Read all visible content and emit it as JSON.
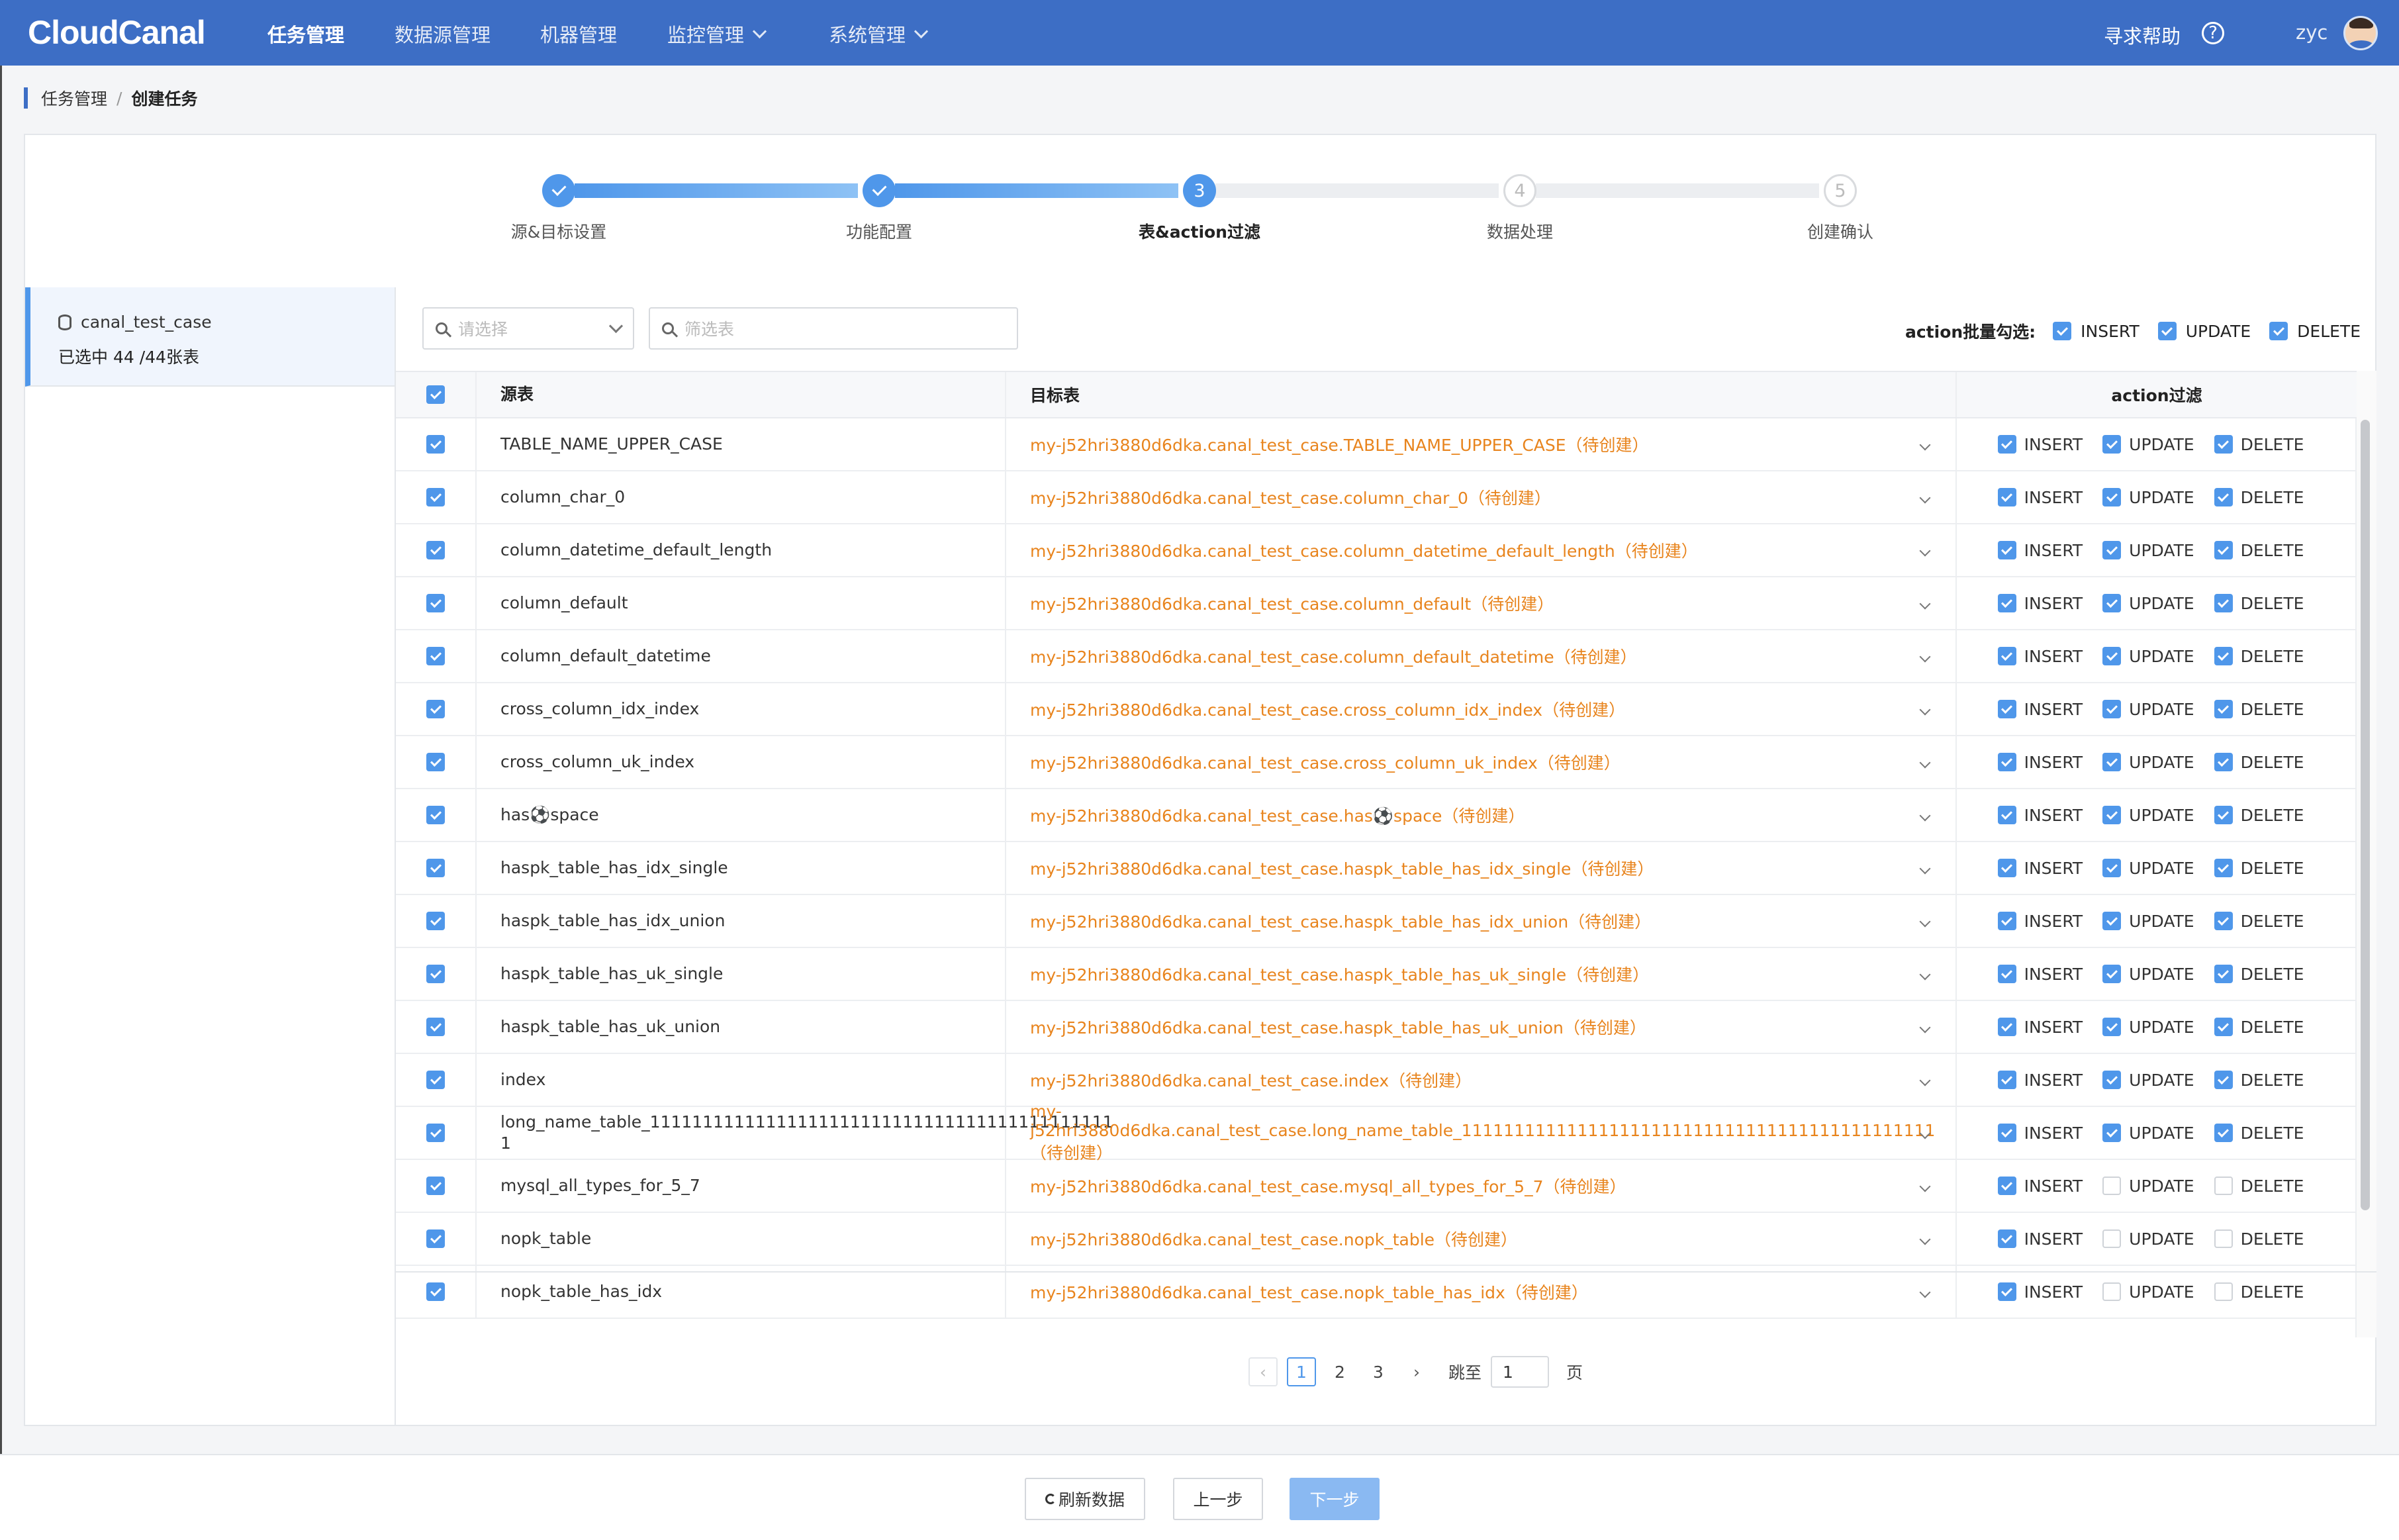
{
  "app": {
    "logo": "CloudCanal"
  },
  "nav": {
    "items": [
      {
        "label": "任务管理",
        "active": true
      },
      {
        "label": "数据源管理"
      },
      {
        "label": "机器管理"
      },
      {
        "label": "监控管理",
        "dropdown": true
      },
      {
        "label": "系统管理",
        "dropdown": true
      }
    ],
    "help": "寻求帮助",
    "user": "zyc"
  },
  "breadcrumb": {
    "parent": "任务管理",
    "sep": "/",
    "current": "创建任务"
  },
  "steps": [
    {
      "label": "源&目标设置",
      "state": "done"
    },
    {
      "label": "功能配置",
      "state": "done"
    },
    {
      "label": "表&action过滤",
      "state": "current",
      "num": "3"
    },
    {
      "label": "数据处理",
      "state": "todo",
      "num": "4"
    },
    {
      "label": "创建确认",
      "state": "todo",
      "num": "5"
    }
  ],
  "left": {
    "db_name": "canal_test_case",
    "count": "已选中 44 /44张表"
  },
  "filters": {
    "select_placeholder": "请选择",
    "search_placeholder": "筛选表"
  },
  "batch": {
    "label": "action批量勾选:",
    "insert": "INSERT",
    "update": "UPDATE",
    "delete": "DELETE"
  },
  "table": {
    "headers": {
      "source": "源表",
      "target": "目标表",
      "action": "action过滤"
    },
    "rows": [
      {
        "src": "TABLE_NAME_UPPER_CASE",
        "tgt": "my-j52hri3880d6dka.canal_test_case.TABLE_NAME_UPPER_CASE（待创建）",
        "ins": true,
        "upd": true,
        "del": true
      },
      {
        "src": "column_char_0",
        "tgt": "my-j52hri3880d6dka.canal_test_case.column_char_0（待创建）",
        "ins": true,
        "upd": true,
        "del": true
      },
      {
        "src": "column_datetime_default_length",
        "tgt": "my-j52hri3880d6dka.canal_test_case.column_datetime_default_length（待创建）",
        "ins": true,
        "upd": true,
        "del": true
      },
      {
        "src": "column_default",
        "tgt": "my-j52hri3880d6dka.canal_test_case.column_default（待创建）",
        "ins": true,
        "upd": true,
        "del": true
      },
      {
        "src": "column_default_datetime",
        "tgt": "my-j52hri3880d6dka.canal_test_case.column_default_datetime（待创建）",
        "ins": true,
        "upd": true,
        "del": true
      },
      {
        "src": "cross_column_idx_index",
        "tgt": "my-j52hri3880d6dka.canal_test_case.cross_column_idx_index（待创建）",
        "ins": true,
        "upd": true,
        "del": true
      },
      {
        "src": "cross_column_uk_index",
        "tgt": "my-j52hri3880d6dka.canal_test_case.cross_column_uk_index（待创建）",
        "ins": true,
        "upd": true,
        "del": true
      },
      {
        "src": "has⚽space",
        "tgt": "my-j52hri3880d6dka.canal_test_case.has⚽space（待创建）",
        "ins": true,
        "upd": true,
        "del": true
      },
      {
        "src": "haspk_table_has_idx_single",
        "tgt": "my-j52hri3880d6dka.canal_test_case.haspk_table_has_idx_single（待创建）",
        "ins": true,
        "upd": true,
        "del": true
      },
      {
        "src": "haspk_table_has_idx_union",
        "tgt": "my-j52hri3880d6dka.canal_test_case.haspk_table_has_idx_union（待创建）",
        "ins": true,
        "upd": true,
        "del": true
      },
      {
        "src": "haspk_table_has_uk_single",
        "tgt": "my-j52hri3880d6dka.canal_test_case.haspk_table_has_uk_single（待创建）",
        "ins": true,
        "upd": true,
        "del": true
      },
      {
        "src": "haspk_table_has_uk_union",
        "tgt": "my-j52hri3880d6dka.canal_test_case.haspk_table_has_uk_union（待创建）",
        "ins": true,
        "upd": true,
        "del": true
      },
      {
        "src": "index",
        "tgt": "my-j52hri3880d6dka.canal_test_case.index（待创建）",
        "ins": true,
        "upd": true,
        "del": true
      },
      {
        "src": "long_name_table_11111111111111111111111111111111111111111111 1",
        "tgt": "my-j52hri3880d6dka.canal_test_case.long_name_table_111111111111111111111111111111111111111111111（待创建）",
        "ins": true,
        "upd": true,
        "del": true
      },
      {
        "src": "mysql_all_types_for_5_7",
        "tgt": "my-j52hri3880d6dka.canal_test_case.mysql_all_types_for_5_7（待创建）",
        "ins": true,
        "upd": false,
        "del": false
      },
      {
        "src": "nopk_table",
        "tgt": "my-j52hri3880d6dka.canal_test_case.nopk_table（待创建）",
        "ins": true,
        "upd": false,
        "del": false
      },
      {
        "src": "nopk_table_has_idx",
        "tgt": "my-j52hri3880d6dka.canal_test_case.nopk_table_has_idx（待创建）",
        "ins": true,
        "upd": false,
        "del": false
      }
    ]
  },
  "pagination": {
    "pages": [
      "1",
      "2",
      "3"
    ],
    "current": "1",
    "jump_label": "跳至",
    "jump_value": "1",
    "page_suffix": "页"
  },
  "footer": {
    "refresh": "刷新数据",
    "prev": "上一步",
    "next": "下一步"
  },
  "colors": {
    "topbar": "#3d6ec5",
    "accent": "#4f97ea",
    "target_text": "#e8841d"
  }
}
